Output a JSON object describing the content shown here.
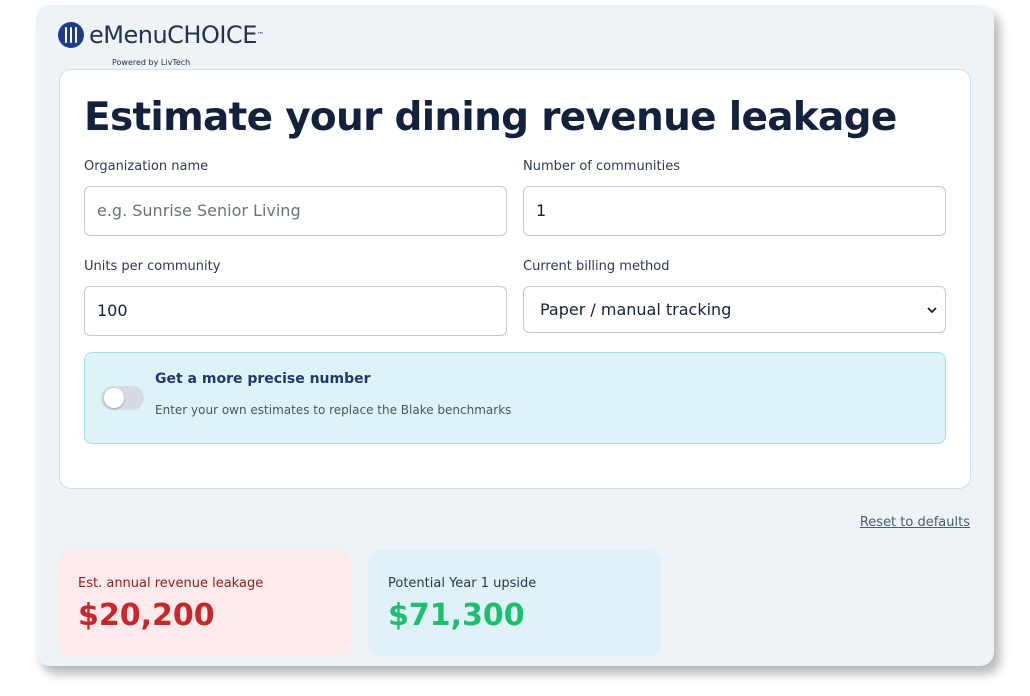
{
  "brand": {
    "name": "eMenuCHOICE",
    "trademark": "™",
    "tagline": "Powered by LivTech"
  },
  "form": {
    "title": "Estimate your dining revenue leakage",
    "org_name": {
      "label": "Organization name",
      "value": "",
      "placeholder": "e.g. Sunrise Senior Living"
    },
    "communities": {
      "label": "Number of communities",
      "value": "1"
    },
    "units": {
      "label": "Units per community",
      "value": "100"
    },
    "billing": {
      "label": "Current billing method",
      "value": "Paper / manual tracking"
    },
    "precise": {
      "title": "Get a more precise number",
      "description": "Enter your own estimates to replace the Blake benchmarks",
      "enabled": false
    }
  },
  "reset_label": "Reset to defaults",
  "results": {
    "leakage": {
      "label": "Est. annual revenue leakage",
      "value": "$20,200"
    },
    "upside": {
      "label": "Potential Year 1 upside",
      "value": "$71,300"
    }
  },
  "colors": {
    "navy": "#13213c",
    "brand_blue": "#1f3b8a",
    "leak_red": "#c8262a",
    "upside_green": "#1bbf6f",
    "panel_teal": "#def3f7"
  },
  "icons": [
    "fork-knife-logo-icon",
    "chevron-down-icon"
  ]
}
